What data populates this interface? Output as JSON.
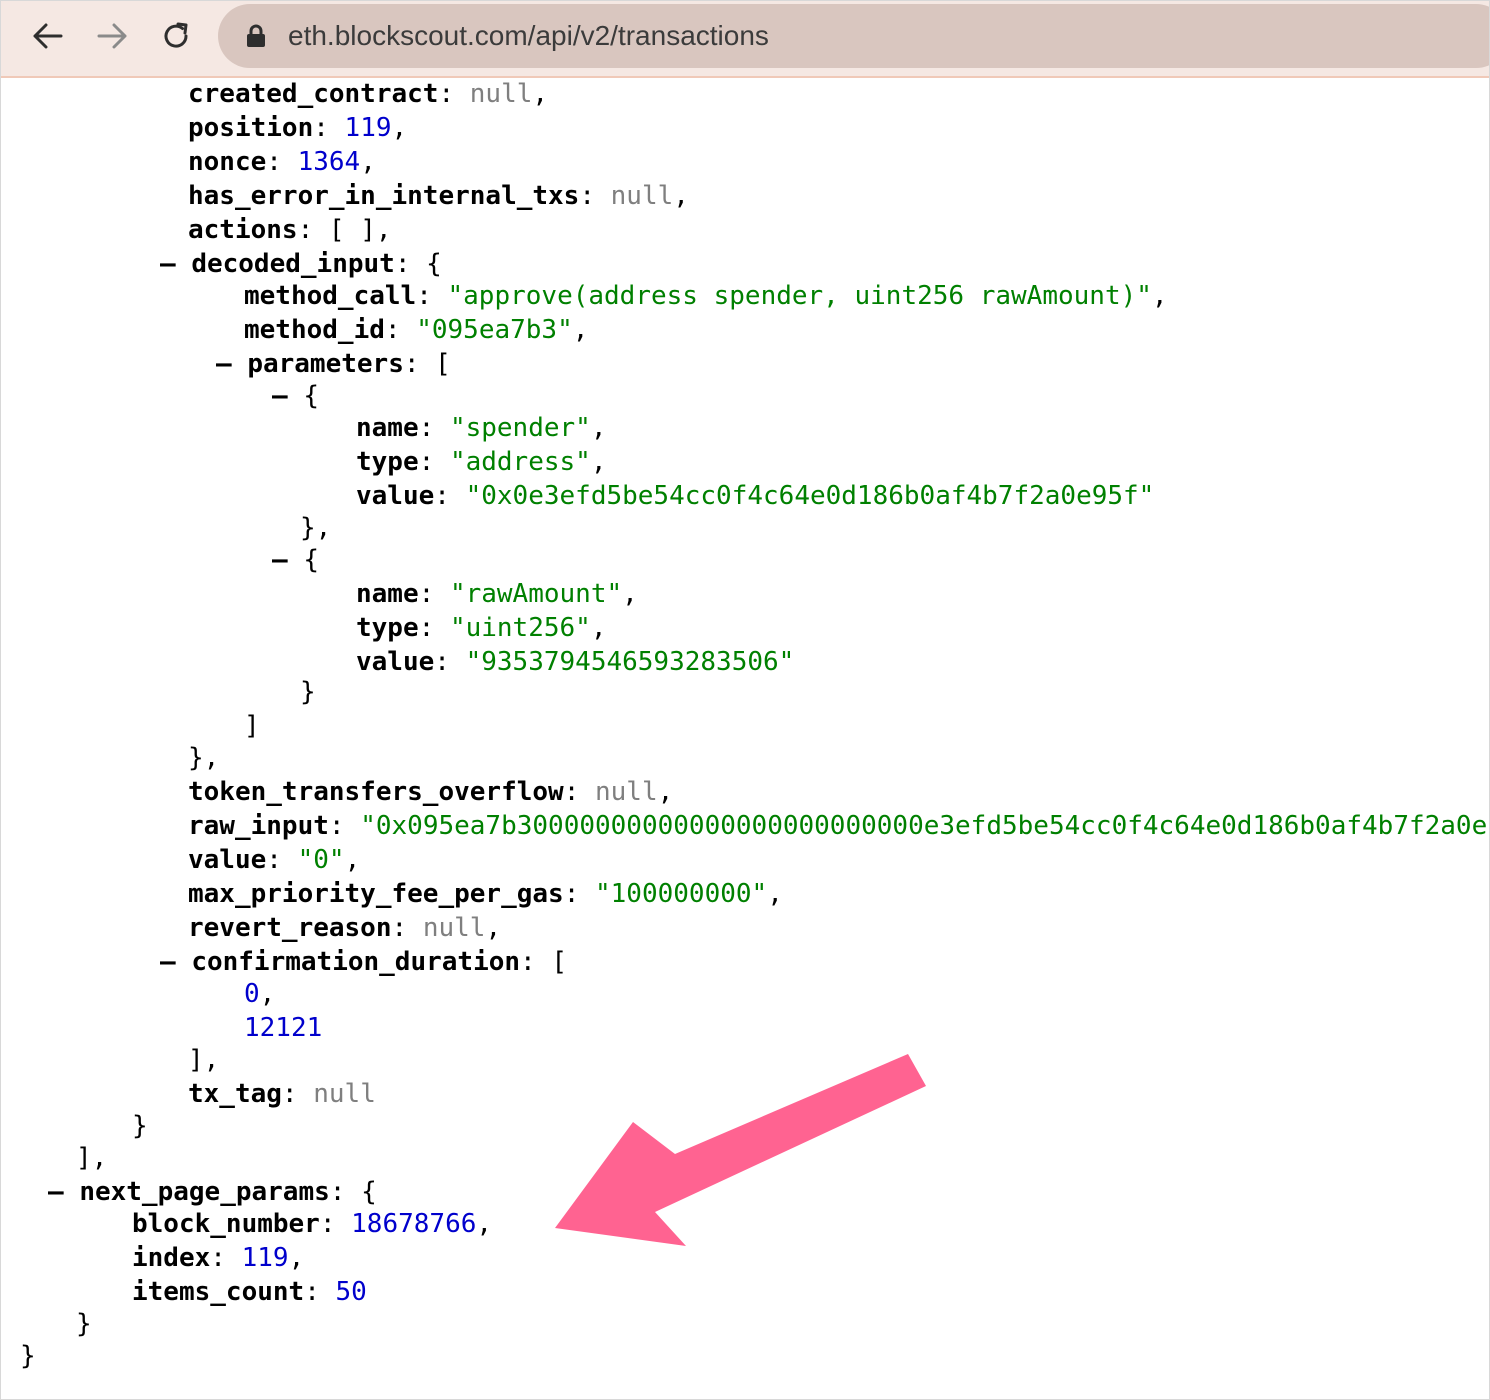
{
  "browser": {
    "url": "eth.blockscout.com/api/v2/transactions",
    "icons": {
      "back": "back-arrow-icon",
      "forward": "forward-arrow-icon",
      "reload": "reload-icon",
      "lock": "lock-icon"
    }
  },
  "colors": {
    "key": "#000000",
    "string": "#008000",
    "number": "#0000cc",
    "null": "#7f7f7f",
    "annotation_arrow": "#ff5f8f"
  },
  "json_lines": [
    {
      "toggle": "",
      "key": "created_contract",
      "open": "",
      "value": "null",
      "kind": "null",
      "after": ","
    },
    {
      "toggle": "",
      "key": "position",
      "open": "",
      "value": "119",
      "kind": "number",
      "after": ","
    },
    {
      "toggle": "",
      "key": "nonce",
      "open": "",
      "value": "1364",
      "kind": "number",
      "after": ","
    },
    {
      "toggle": "",
      "key": "has_error_in_internal_txs",
      "open": "",
      "value": "null",
      "kind": "null",
      "after": ","
    },
    {
      "toggle": "",
      "key": "actions",
      "open": "[ ]",
      "value": "",
      "kind": "",
      "after": ","
    },
    {
      "toggle": "–",
      "key": "decoded_input",
      "open": "{",
      "value": "",
      "kind": "",
      "after": ""
    },
    {
      "toggle": "",
      "key": "method_call",
      "open": "",
      "value": "\"approve(address spender, uint256 rawAmount)\"",
      "kind": "string",
      "after": ","
    },
    {
      "toggle": "",
      "key": "method_id",
      "open": "",
      "value": "\"095ea7b3\"",
      "kind": "string",
      "after": ","
    },
    {
      "toggle": "–",
      "key": "parameters",
      "open": "[",
      "value": "",
      "kind": "",
      "after": ""
    },
    {
      "toggle": "–",
      "key": "",
      "open": "{",
      "value": "",
      "kind": "",
      "after": ""
    },
    {
      "toggle": "",
      "key": "name",
      "open": "",
      "value": "\"spender\"",
      "kind": "string",
      "after": ","
    },
    {
      "toggle": "",
      "key": "type",
      "open": "",
      "value": "\"address\"",
      "kind": "string",
      "after": ","
    },
    {
      "toggle": "",
      "key": "value",
      "open": "",
      "value": "\"0x0e3efd5be54cc0f4c64e0d186b0af4b7f2a0e95f\"",
      "kind": "string",
      "after": ""
    },
    {
      "toggle": "",
      "key": "",
      "open": "},",
      "value": "",
      "kind": "",
      "after": ""
    },
    {
      "toggle": "–",
      "key": "",
      "open": "{",
      "value": "",
      "kind": "",
      "after": ""
    },
    {
      "toggle": "",
      "key": "name",
      "open": "",
      "value": "\"rawAmount\"",
      "kind": "string",
      "after": ","
    },
    {
      "toggle": "",
      "key": "type",
      "open": "",
      "value": "\"uint256\"",
      "kind": "string",
      "after": ","
    },
    {
      "toggle": "",
      "key": "value",
      "open": "",
      "value": "\"9353794546593283506\"",
      "kind": "string",
      "after": ""
    },
    {
      "toggle": "",
      "key": "",
      "open": "}",
      "value": "",
      "kind": "",
      "after": ""
    },
    {
      "toggle": "",
      "key": "",
      "open": "]",
      "value": "",
      "kind": "",
      "after": ""
    },
    {
      "toggle": "",
      "key": "",
      "open": "},",
      "value": "",
      "kind": "",
      "after": ""
    },
    {
      "toggle": "",
      "key": "token_transfers_overflow",
      "open": "",
      "value": "null",
      "kind": "null",
      "after": ","
    },
    {
      "toggle": "",
      "key": "raw_input",
      "open": "",
      "value": "\"0x095ea7b30000000000000000000000000e3efd5be54cc0f4c64e0d186b0af4b7f2a0e",
      "kind": "string",
      "after": ""
    },
    {
      "toggle": "",
      "key": "value",
      "open": "",
      "value": "\"0\"",
      "kind": "string",
      "after": ","
    },
    {
      "toggle": "",
      "key": "max_priority_fee_per_gas",
      "open": "",
      "value": "\"100000000\"",
      "kind": "string",
      "after": ","
    },
    {
      "toggle": "",
      "key": "revert_reason",
      "open": "",
      "value": "null",
      "kind": "null",
      "after": ","
    },
    {
      "toggle": "–",
      "key": "confirmation_duration",
      "open": "[",
      "value": "",
      "kind": "",
      "after": ""
    },
    {
      "toggle": "",
      "key": "",
      "open": "",
      "value": "0",
      "kind": "number",
      "after": ","
    },
    {
      "toggle": "",
      "key": "",
      "open": "",
      "value": "12121",
      "kind": "number",
      "after": ""
    },
    {
      "toggle": "",
      "key": "",
      "open": "],",
      "value": "",
      "kind": "",
      "after": ""
    },
    {
      "toggle": "",
      "key": "tx_tag",
      "open": "",
      "value": "null",
      "kind": "null",
      "after": ""
    },
    {
      "toggle": "",
      "key": "",
      "open": "}",
      "value": "",
      "kind": "",
      "after": ""
    },
    {
      "toggle": "",
      "key": "",
      "open": "],",
      "value": "",
      "kind": "",
      "after": ""
    },
    {
      "toggle": "–",
      "key": "next_page_params",
      "open": "{",
      "value": "",
      "kind": "",
      "after": ""
    },
    {
      "toggle": "",
      "key": "block_number",
      "open": "",
      "value": "18678766",
      "kind": "number",
      "after": ","
    },
    {
      "toggle": "",
      "key": "index",
      "open": "",
      "value": "119",
      "kind": "number",
      "after": ","
    },
    {
      "toggle": "",
      "key": "items_count",
      "open": "",
      "value": "50",
      "kind": "number",
      "after": ""
    },
    {
      "toggle": "",
      "key": "",
      "open": "}",
      "value": "",
      "kind": "",
      "after": ""
    },
    {
      "toggle": "",
      "key": "",
      "open": "}",
      "value": "",
      "kind": "",
      "after": ""
    }
  ]
}
